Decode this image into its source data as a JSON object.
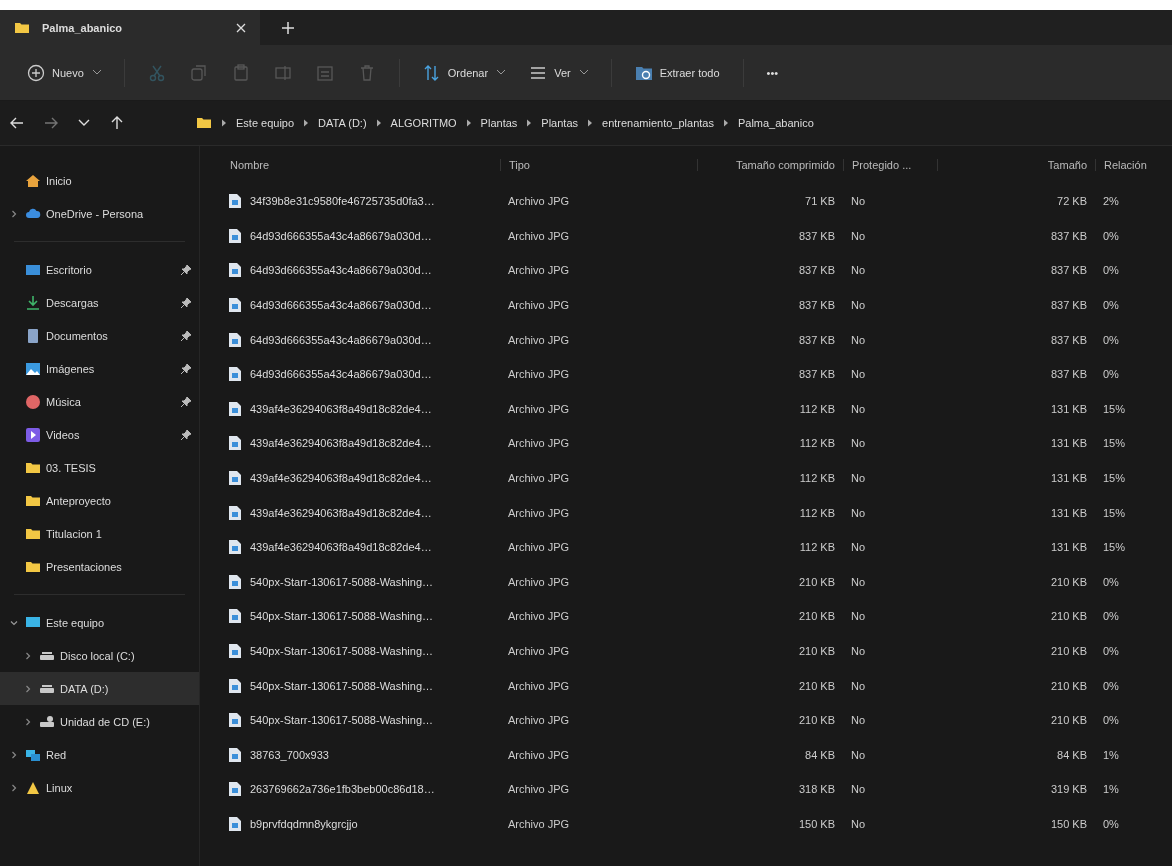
{
  "tabs": [
    {
      "title": "Palma_abanico",
      "selected": true
    }
  ],
  "toolbar": [
    {
      "kind": "new",
      "label": "Nuevo",
      "disabled": false
    },
    {
      "kind": "cut",
      "disabled": true
    },
    {
      "kind": "copy",
      "disabled": true
    },
    {
      "kind": "paste",
      "disabled": true
    },
    {
      "kind": "rename",
      "disabled": true
    },
    {
      "kind": "share",
      "disabled": true
    },
    {
      "kind": "delete",
      "disabled": true
    },
    {
      "kind": "sort",
      "label": "Ordenar",
      "disabled": false
    },
    {
      "kind": "view",
      "label": "Ver",
      "disabled": false
    },
    {
      "kind": "extract",
      "label": "Extraer todo",
      "disabled": false
    },
    {
      "kind": "more",
      "label": "•••",
      "disabled": false
    }
  ],
  "breadcrumb": [
    "Este equipo",
    "DATA (D:)",
    "ALGORITMO",
    "Plantas",
    "Plantas",
    "entrenamiento_plantas",
    "Palma_abanico"
  ],
  "sidebar": [
    [
      {
        "label": "Inicio",
        "kind": "home",
        "selected": false,
        "pinned": false
      },
      {
        "label": "OneDrive - Persona",
        "kind": "cloud",
        "selected": false,
        "pinned": false,
        "expanded": false
      }
    ],
    [
      {
        "label": "Escritorio",
        "kind": "desktop",
        "selected": false,
        "pinned": true
      },
      {
        "label": "Descargas",
        "kind": "download",
        "selected": false,
        "pinned": true
      },
      {
        "label": "Documentos",
        "kind": "document",
        "selected": false,
        "pinned": true
      },
      {
        "label": "Imágenes",
        "kind": "image",
        "selected": false,
        "pinned": true
      },
      {
        "label": "Música",
        "kind": "music",
        "selected": false,
        "pinned": true
      },
      {
        "label": "Videos",
        "kind": "video",
        "selected": false,
        "pinned": true
      },
      {
        "label": "03. TESIS",
        "kind": "folder",
        "selected": false,
        "pinned": false
      },
      {
        "label": "Anteproyecto",
        "kind": "folder",
        "selected": false,
        "pinned": false
      },
      {
        "label": "Titulacion 1",
        "kind": "folder",
        "selected": false,
        "pinned": false
      },
      {
        "label": "Presentaciones",
        "kind": "folder",
        "selected": false,
        "pinned": false
      }
    ],
    [
      {
        "label": "Este equipo",
        "kind": "pc",
        "selected": false,
        "pinned": false,
        "expanded": true,
        "children": [
          {
            "label": "Disco local (C:)",
            "kind": "drive",
            "selected": false,
            "pinned": false,
            "expanded": false
          },
          {
            "label": "DATA (D:)",
            "kind": "drive",
            "selected": true,
            "pinned": false,
            "expanded": false
          },
          {
            "label": "Unidad de CD (E:)",
            "kind": "cd",
            "selected": false,
            "pinned": false,
            "expanded": false
          }
        ]
      },
      {
        "label": "Red",
        "kind": "network",
        "selected": false,
        "pinned": false,
        "expanded": false
      },
      {
        "label": "Linux",
        "kind": "linux",
        "selected": false,
        "pinned": false,
        "expanded": false
      }
    ]
  ],
  "table": {
    "columns": [
      {
        "label": "Nombre"
      },
      {
        "label": "Tipo"
      },
      {
        "label": "Tamaño comprimido"
      },
      {
        "label": "Protegido ..."
      },
      {
        "label": "Tamaño"
      },
      {
        "label": "Relación"
      }
    ],
    "rows": [
      [
        "34f39b8e31c9580fe46725735d0fa3…",
        "Archivo JPG",
        "71 KB",
        "No",
        "72 KB",
        "2%"
      ],
      [
        "64d93d666355a43c4a86679a030d…",
        "Archivo JPG",
        "837 KB",
        "No",
        "837 KB",
        "0%"
      ],
      [
        "64d93d666355a43c4a86679a030d…",
        "Archivo JPG",
        "837 KB",
        "No",
        "837 KB",
        "0%"
      ],
      [
        "64d93d666355a43c4a86679a030d…",
        "Archivo JPG",
        "837 KB",
        "No",
        "837 KB",
        "0%"
      ],
      [
        "64d93d666355a43c4a86679a030d…",
        "Archivo JPG",
        "837 KB",
        "No",
        "837 KB",
        "0%"
      ],
      [
        "64d93d666355a43c4a86679a030d…",
        "Archivo JPG",
        "837 KB",
        "No",
        "837 KB",
        "0%"
      ],
      [
        "439af4e36294063f8a49d18c82de4…",
        "Archivo JPG",
        "112 KB",
        "No",
        "131 KB",
        "15%"
      ],
      [
        "439af4e36294063f8a49d18c82de4…",
        "Archivo JPG",
        "112 KB",
        "No",
        "131 KB",
        "15%"
      ],
      [
        "439af4e36294063f8a49d18c82de4…",
        "Archivo JPG",
        "112 KB",
        "No",
        "131 KB",
        "15%"
      ],
      [
        "439af4e36294063f8a49d18c82de4…",
        "Archivo JPG",
        "112 KB",
        "No",
        "131 KB",
        "15%"
      ],
      [
        "439af4e36294063f8a49d18c82de4…",
        "Archivo JPG",
        "112 KB",
        "No",
        "131 KB",
        "15%"
      ],
      [
        "540px-Starr-130617-5088-Washing…",
        "Archivo JPG",
        "210 KB",
        "No",
        "210 KB",
        "0%"
      ],
      [
        "540px-Starr-130617-5088-Washing…",
        "Archivo JPG",
        "210 KB",
        "No",
        "210 KB",
        "0%"
      ],
      [
        "540px-Starr-130617-5088-Washing…",
        "Archivo JPG",
        "210 KB",
        "No",
        "210 KB",
        "0%"
      ],
      [
        "540px-Starr-130617-5088-Washing…",
        "Archivo JPG",
        "210 KB",
        "No",
        "210 KB",
        "0%"
      ],
      [
        "540px-Starr-130617-5088-Washing…",
        "Archivo JPG",
        "210 KB",
        "No",
        "210 KB",
        "0%"
      ],
      [
        "38763_700x933",
        "Archivo JPG",
        "84 KB",
        "No",
        "84 KB",
        "1%"
      ],
      [
        "263769662a736e1fb3beb00c86d18…",
        "Archivo JPG",
        "318 KB",
        "No",
        "319 KB",
        "1%"
      ],
      [
        "b9prvfdqdmn8ykgrcjjo",
        "Archivo JPG",
        "150 KB",
        "No",
        "150 KB",
        "0%"
      ]
    ]
  }
}
